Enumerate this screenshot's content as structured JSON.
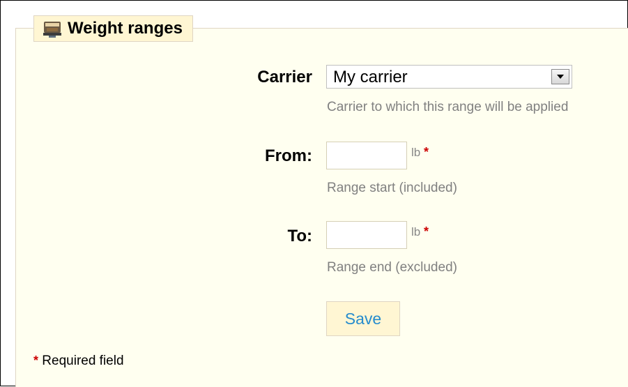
{
  "legend": {
    "title": "Weight ranges",
    "icon": "scale-icon"
  },
  "carrier": {
    "label": "Carrier",
    "selected": "My carrier",
    "hint": "Carrier to which this range will be applied"
  },
  "from": {
    "label": "From:",
    "value": "",
    "unit": "lb",
    "required_mark": "*",
    "hint": "Range start (included)"
  },
  "to": {
    "label": "To:",
    "value": "",
    "unit": "lb",
    "required_mark": "*",
    "hint": "Range end (excluded)"
  },
  "save_label": "Save",
  "required_note": {
    "mark": "*",
    "text": "Required field"
  },
  "colors": {
    "panel_bg": "#fffff0",
    "legend_bg": "#fff6d3",
    "save_text": "#268ccd",
    "required": "#cc0000",
    "hint": "#808080"
  }
}
